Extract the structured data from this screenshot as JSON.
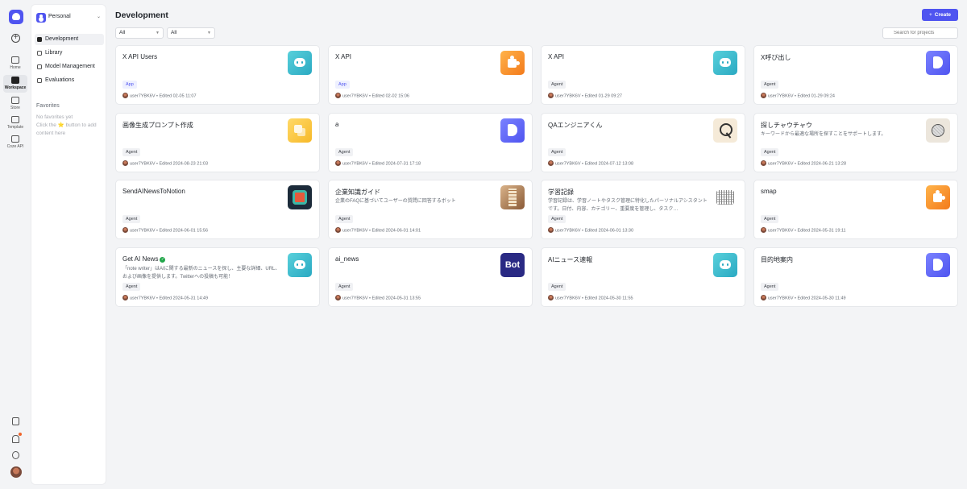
{
  "rail": {
    "items": [
      {
        "label": "Home",
        "icon": "home-icon"
      },
      {
        "label": "Workspace",
        "icon": "workspace-icon",
        "active": true
      },
      {
        "label": "Store",
        "icon": "store-icon"
      },
      {
        "label": "Template",
        "icon": "template-icon"
      },
      {
        "label": "Coze API",
        "icon": "api-icon"
      }
    ]
  },
  "sidebar": {
    "space_label": "Personal",
    "nav": [
      {
        "label": "Development",
        "active": true
      },
      {
        "label": "Library"
      },
      {
        "label": "Model Management"
      },
      {
        "label": "Evaluations"
      }
    ],
    "favorites_title": "Favorites",
    "favorites_empty": "No favorites yet\nClick the ⭐ button to add content here"
  },
  "main": {
    "title": "Development",
    "create_label": "Create",
    "filter1": "All",
    "filter2": "All",
    "search_placeholder": "Search for projects"
  },
  "cards": [
    {
      "title": "X API Users",
      "desc": "",
      "badge": "App",
      "meta": "user7YBK6V • Edited 02-05 11:07",
      "thumb": "t-chat",
      "verified": false
    },
    {
      "title": "X API",
      "desc": "",
      "badge": "App",
      "meta": "user7YBK6V • Edited 02-02 15:06",
      "thumb": "t-puzzle",
      "verified": false
    },
    {
      "title": "X API",
      "desc": "",
      "badge": "Agent",
      "meta": "user7YBK6V • Edited 01-29 09:27",
      "thumb": "t-chat",
      "verified": false
    },
    {
      "title": "X呼び出し",
      "desc": "",
      "badge": "Agent",
      "meta": "user7YBK6V • Edited 01-29 09:24",
      "thumb": "t-doc",
      "verified": false
    },
    {
      "title": "画像生成プロンプト作成",
      "desc": "",
      "badge": "Agent",
      "meta": "user7YBK6V • Edited 2024-08-23 21:03",
      "thumb": "t-yellow",
      "verified": false
    },
    {
      "title": "a",
      "desc": "",
      "badge": "Agent",
      "meta": "user7YBK6V • Edited 2024-07-31 17:18",
      "thumb": "t-doc",
      "verified": false
    },
    {
      "title": "QAエンジニアくん",
      "desc": "",
      "badge": "Agent",
      "meta": "user7YBK6V • Edited 2024-07-12 13:08",
      "thumb": "t-qa",
      "verified": false
    },
    {
      "title": "探しチャウチャウ",
      "desc": "キーワードから最適な場所を探すことをサポートします。",
      "badge": "Agent",
      "meta": "user7YBK6V • Edited 2024-06-21 13:28",
      "thumb": "t-search",
      "verified": false
    },
    {
      "title": "SendAINewsToNotion",
      "desc": "",
      "badge": "Agent",
      "meta": "user7YBK6V • Edited 2024-06-01 15:56",
      "thumb": "t-notion",
      "verified": false
    },
    {
      "title": "企業知識ガイド",
      "desc": "企業のFAQに基づいてユーザーの質問に回答するボット",
      "badge": "Agent",
      "meta": "user7YBK6V • Edited 2024-06-01 14:01",
      "thumb": "t-book",
      "verified": false
    },
    {
      "title": "学習記録",
      "desc": "学習記録は、学習ノートやタスク管理に特化したパーソナルアシスタントです。日付、内容、カテゴリー、重要度を管理し、タスク…",
      "badge": "Agent",
      "meta": "user7YBK6V • Edited 2024-06-01 13:30",
      "thumb": "t-sketch",
      "verified": false
    },
    {
      "title": "smap",
      "desc": "",
      "badge": "Agent",
      "meta": "user7YBK6V • Edited 2024-05-31 19:11",
      "thumb": "t-puzzle",
      "verified": false
    },
    {
      "title": "Get AI News",
      "desc": "「note writer」はAIに関する最新のニュースを探し、主要な詳細、URL、および画像を提供します。Twitterへの投稿も可能！",
      "badge": "Agent",
      "meta": "user7YBK6V • Edited 2024-05-31 14:49",
      "thumb": "t-chat",
      "verified": true
    },
    {
      "title": "ai_news",
      "desc": "",
      "badge": "Agent",
      "meta": "user7YBK6V • Edited 2024-05-31 13:55",
      "thumb": "t-bot",
      "thumb_text": "Bot",
      "verified": false
    },
    {
      "title": "AIニュース速報",
      "desc": "",
      "badge": "Agent",
      "meta": "user7YBK6V • Edited 2024-05-30 11:55",
      "thumb": "t-chat",
      "verified": false
    },
    {
      "title": "目的地案内",
      "desc": "",
      "badge": "Agent",
      "meta": "user7YBK6V • Edited 2024-05-30 11:49",
      "thumb": "t-doc",
      "verified": false
    }
  ]
}
